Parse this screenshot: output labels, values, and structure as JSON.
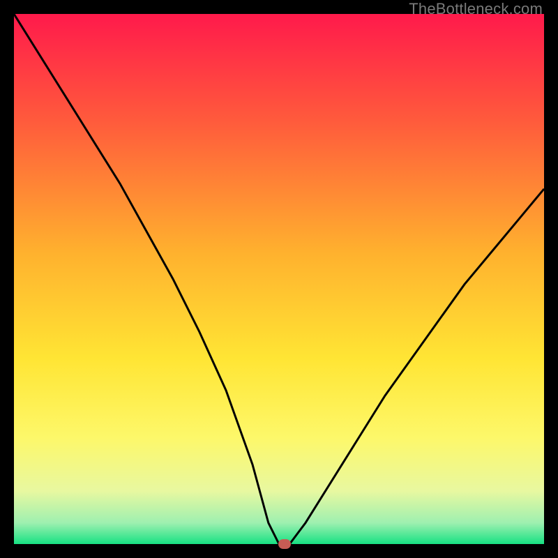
{
  "watermark": "TheBottleneck.com",
  "chart_data": {
    "type": "line",
    "title": "",
    "xlabel": "",
    "ylabel": "",
    "xlim": [
      0,
      100
    ],
    "ylim": [
      0,
      100
    ],
    "grid": false,
    "legend": false,
    "series": [
      {
        "name": "bottleneck-curve",
        "x": [
          0,
          5,
          10,
          15,
          20,
          25,
          30,
          35,
          40,
          45,
          48,
          50,
          52,
          55,
          60,
          65,
          70,
          75,
          80,
          85,
          90,
          95,
          100
        ],
        "values": [
          100,
          92,
          84,
          76,
          68,
          59,
          50,
          40,
          29,
          15,
          4,
          0,
          0,
          4,
          12,
          20,
          28,
          35,
          42,
          49,
          55,
          61,
          67
        ]
      }
    ],
    "marker": {
      "x": 51,
      "y": 0,
      "color": "#c65c54"
    },
    "gradient_stops": [
      {
        "offset": 0.0,
        "color": "#ff1a4b"
      },
      {
        "offset": 0.2,
        "color": "#ff5a3c"
      },
      {
        "offset": 0.45,
        "color": "#ffb12e"
      },
      {
        "offset": 0.65,
        "color": "#ffe534"
      },
      {
        "offset": 0.8,
        "color": "#fdf86a"
      },
      {
        "offset": 0.9,
        "color": "#e8f8a0"
      },
      {
        "offset": 0.96,
        "color": "#9ef0b0"
      },
      {
        "offset": 1.0,
        "color": "#17e183"
      }
    ]
  }
}
